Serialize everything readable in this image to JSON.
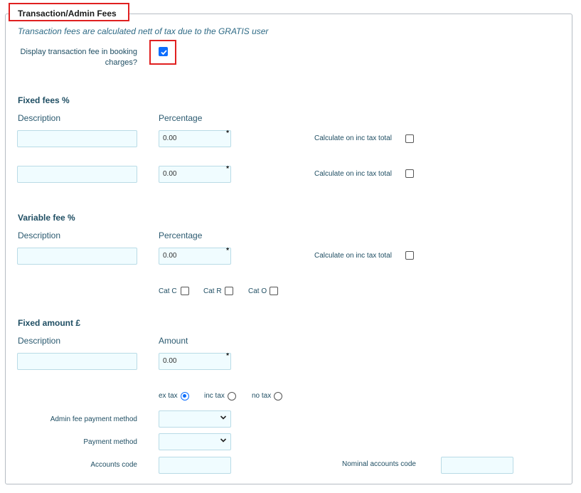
{
  "section": {
    "title": "Transaction/Admin Fees",
    "note": "Transaction fees are calculated nett of tax due to the GRATIS user",
    "display_fee_label": "Display transaction fee in booking charges?",
    "display_fee_checked": true
  },
  "fixed_fees": {
    "heading": "Fixed fees %",
    "description_header": "Description",
    "percentage_header": "Percentage",
    "rows": [
      {
        "description": "",
        "percentage": "0.00",
        "inc_tax_label": "Calculate on inc tax total",
        "inc_tax_checked": false
      },
      {
        "description": "",
        "percentage": "0.00",
        "inc_tax_label": "Calculate on inc tax total",
        "inc_tax_checked": false
      }
    ]
  },
  "variable_fee": {
    "heading": "Variable fee %",
    "description_header": "Description",
    "percentage_header": "Percentage",
    "row": {
      "description": "",
      "percentage": "0.00",
      "inc_tax_label": "Calculate on inc tax total",
      "inc_tax_checked": false
    },
    "categories": [
      {
        "label": "Cat C",
        "checked": false
      },
      {
        "label": "Cat R",
        "checked": false
      },
      {
        "label": "Cat O",
        "checked": false
      }
    ]
  },
  "fixed_amount": {
    "heading": "Fixed amount £",
    "description_header": "Description",
    "amount_header": "Amount",
    "description": "",
    "amount": "0.00",
    "tax_options": [
      {
        "label": "ex tax",
        "selected": true
      },
      {
        "label": "inc tax",
        "selected": false
      },
      {
        "label": "no tax",
        "selected": false
      }
    ],
    "admin_fee_payment_method_label": "Admin fee payment method",
    "admin_fee_payment_method_value": "",
    "payment_method_label": "Payment method",
    "payment_method_value": "",
    "accounts_code_label": "Accounts code",
    "accounts_code_value": "",
    "nominal_accounts_code_label": "Nominal accounts code",
    "nominal_accounts_code_value": ""
  },
  "required_marker": "*",
  "icons": {
    "checkmark": "check-icon",
    "caret": "chevron-down-icon"
  },
  "colors": {
    "accent": "#0d6efd",
    "highlight": "#e02020",
    "input_bg": "#f0fcff",
    "label": "#1f4e63"
  }
}
